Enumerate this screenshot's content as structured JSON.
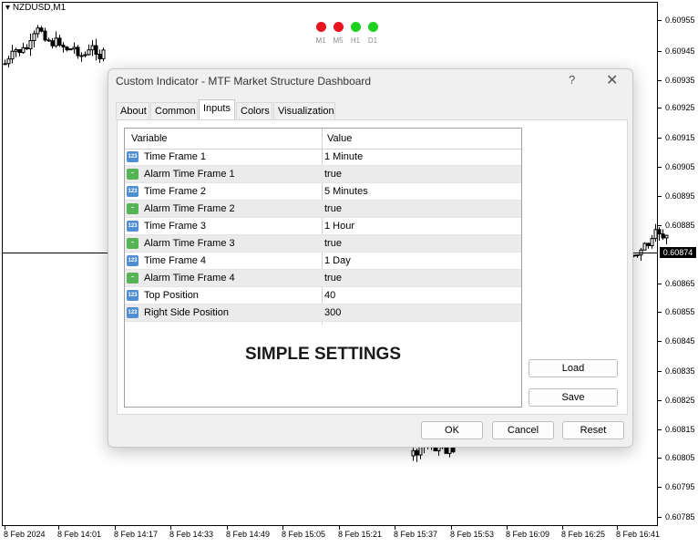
{
  "chart": {
    "symbol": "NZDUSD,M1",
    "current_price": "0.60874",
    "price_labels": [
      "0.60955",
      "0.60945",
      "0.60935",
      "0.60925",
      "0.60915",
      "0.60905",
      "0.60895",
      "0.60885",
      "0.60865",
      "0.60855",
      "0.60845",
      "0.60835",
      "0.60825",
      "0.60815",
      "0.60805",
      "0.60795",
      "0.60785"
    ],
    "time_labels": [
      "8 Feb 2024",
      "8 Feb 14:01",
      "8 Feb 14:17",
      "8 Feb 14:33",
      "8 Feb 14:49",
      "8 Feb 15:05",
      "8 Feb 15:21",
      "8 Feb 15:37",
      "8 Feb 15:53",
      "8 Feb 16:09",
      "8 Feb 16:25",
      "8 Feb 16:41"
    ],
    "timeframes": [
      {
        "label": "M1",
        "color": "#e8141e"
      },
      {
        "label": "M5",
        "color": "#e8141e"
      },
      {
        "label": "H1",
        "color": "#1ed11e"
      },
      {
        "label": "D1",
        "color": "#1ed11e"
      }
    ]
  },
  "dialog": {
    "title": "Custom Indicator - MTF Market Structure Dashboard",
    "help": "?",
    "close": "✕",
    "tabs": [
      "About",
      "Common",
      "Inputs",
      "Colors",
      "Visualization"
    ],
    "active_tab": "Inputs",
    "grid": {
      "headers": [
        "Variable",
        "Value"
      ],
      "rows": [
        {
          "icon": "123",
          "name": "Time Frame 1",
          "value": "1 Minute"
        },
        {
          "icon": "bool",
          "name": "Alarm Time Frame 1",
          "value": "true"
        },
        {
          "icon": "123",
          "name": "Time Frame 2",
          "value": "5 Minutes"
        },
        {
          "icon": "bool",
          "name": "Alarm Time Frame 2",
          "value": "true"
        },
        {
          "icon": "123",
          "name": "Time Frame 3",
          "value": "1 Hour"
        },
        {
          "icon": "bool",
          "name": "Alarm Time Frame 3",
          "value": "true"
        },
        {
          "icon": "123",
          "name": "Time Frame 4",
          "value": "1 Day"
        },
        {
          "icon": "bool",
          "name": "Alarm Time Frame 4",
          "value": "true"
        },
        {
          "icon": "123",
          "name": "Top Position",
          "value": "40"
        },
        {
          "icon": "123",
          "name": "Right Side Position",
          "value": "300"
        }
      ],
      "overlay_text": "SIMPLE SETTINGS"
    },
    "buttons": {
      "load": "Load",
      "save": "Save",
      "ok": "OK",
      "cancel": "Cancel",
      "reset": "Reset"
    }
  }
}
